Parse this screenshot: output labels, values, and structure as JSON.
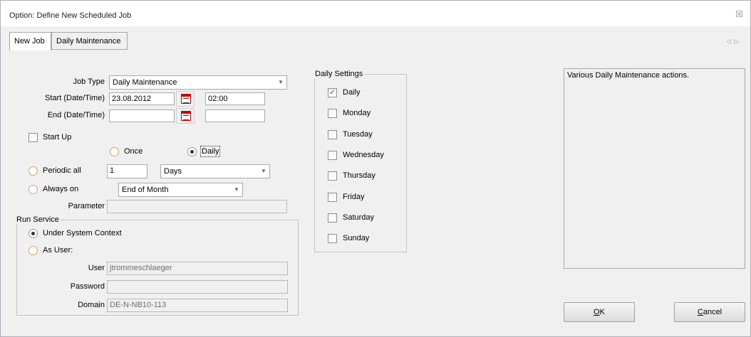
{
  "window": {
    "title": "Option: Define New Scheduled Job",
    "close_glyph": "☒"
  },
  "tabs": [
    {
      "label": "New Job"
    },
    {
      "label": "Daily Maintenance"
    }
  ],
  "tab_scroll": {
    "left": "◁",
    "right": "▷"
  },
  "form": {
    "job_type_label": "Job Type",
    "job_type_value": "Daily Maintenance",
    "start_label": "Start (Date/Time)",
    "start_date": "23.08.2012",
    "start_time": "02:00",
    "end_label": "End (Date/Time)",
    "end_date": "",
    "end_time": "",
    "startup_label": "Start Up",
    "once_label": "Once",
    "daily_label": "Daily",
    "periodic_label": "Periodic all",
    "periodic_value": "1",
    "periodic_unit": "Days",
    "always_label": "Always on",
    "always_value": "End of Month",
    "parameter_label": "Parameter",
    "parameter_value": ""
  },
  "run_service": {
    "legend": "Run Service",
    "system_context_label": "Under System Context",
    "as_user_label": "As User:",
    "user_label": "User",
    "user_value": "jtrommeschlaeger",
    "password_label": "Password",
    "password_value": "",
    "domain_label": "Domain",
    "domain_value": "DE-N-NB10-113"
  },
  "daily_settings": {
    "legend": "Daily Settings",
    "days": [
      {
        "label": "Daily",
        "checked": true
      },
      {
        "label": "Monday",
        "checked": false
      },
      {
        "label": "Tuesday",
        "checked": false
      },
      {
        "label": "Wednesday",
        "checked": false
      },
      {
        "label": "Thursday",
        "checked": false
      },
      {
        "label": "Friday",
        "checked": false
      },
      {
        "label": "Saturday",
        "checked": false
      },
      {
        "label": "Sunday",
        "checked": false
      }
    ]
  },
  "description": "Various Daily Maintenance actions.",
  "buttons": {
    "ok_mnemonic": "O",
    "ok_rest": "K",
    "cancel_mnemonic": "C",
    "cancel_rest": "ancel"
  }
}
